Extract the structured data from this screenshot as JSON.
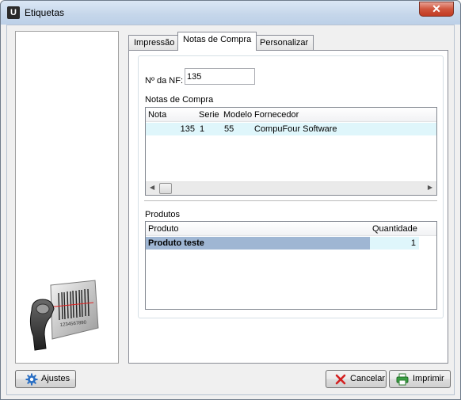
{
  "window": {
    "title": "Etiquetas",
    "app_icon": "app-logo-icon",
    "close_icon": "close-icon"
  },
  "tabs": [
    {
      "label": "Impressão",
      "active": false
    },
    {
      "label": "Notas de Compra",
      "active": true
    },
    {
      "label": "Personalizar",
      "active": false
    }
  ],
  "nf": {
    "label": "Nº da NF:",
    "value": "135"
  },
  "notas": {
    "section_label": "Notas de Compra",
    "columns": [
      "Nota",
      "Serie",
      "Modelo",
      "Fornecedor"
    ],
    "rows": [
      {
        "nota": "135",
        "serie": "1",
        "modelo": "55",
        "fornecedor": "CompuFour Software"
      }
    ]
  },
  "produtos": {
    "section_label": "Produtos",
    "columns": [
      "Produto",
      "Quantidade"
    ],
    "rows": [
      {
        "produto": "Produto teste",
        "quantidade": "1"
      }
    ]
  },
  "buttons": {
    "ajustes": {
      "label": "Ajustes",
      "icon": "gear-icon"
    },
    "cancelar": {
      "label": "Cancelar",
      "icon": "x-icon"
    },
    "imprimir": {
      "label": "Imprimir",
      "icon": "printer-icon"
    }
  },
  "illustration": {
    "icon": "barcode-scanner-icon",
    "barcode_text": "1234567890"
  },
  "colors": {
    "selected_row": "#dff6fb",
    "selected_product": "#9fb6d3",
    "title_bar": "#c5d6ea",
    "close_button": "#c13a22"
  }
}
